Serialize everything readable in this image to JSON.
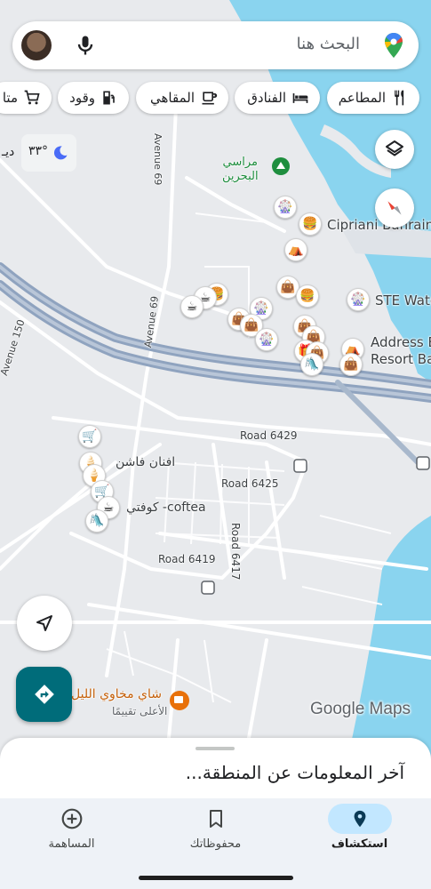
{
  "search": {
    "placeholder": "البحث هنا"
  },
  "chips": [
    {
      "label": "المطاعم",
      "icon": "fork-knife-icon"
    },
    {
      "label": "الفنادق",
      "icon": "bed-icon"
    },
    {
      "label": "المقاهي",
      "icon": "coffee-icon"
    },
    {
      "label": "وقود",
      "icon": "gas-pump-icon"
    },
    {
      "label": "متا",
      "icon": "cart-icon"
    }
  ],
  "weather": {
    "temp": "٣٣°",
    "city": "ديـ"
  },
  "map_labels": {
    "marina": "مراسي\nالبحرين",
    "cipriani": "Cipriani Bahrain",
    "ste": "STE Wate",
    "address": "Address B\nResort Ba",
    "afnan": "افنان فاشن",
    "coftea": "coftea- كوفتي",
    "shay": "شاي مخاوي الليل",
    "shay_sub": "الأعلى تقييمًا",
    "avenue69a": "Avenue 69",
    "avenue69b": "Avenue 69",
    "avenue150": "Avenue 150",
    "road6429": "Road 6429",
    "road6425": "Road 6425",
    "road6419": "Road 6419",
    "road6417": "Road 6417"
  },
  "google_maps": "Google Maps",
  "sheet": {
    "title": "آخر المعلومات عن المنطقة..."
  },
  "nav": [
    {
      "label": "المساهمة",
      "icon": "plus-circle-icon"
    },
    {
      "label": "محفوظاتك",
      "icon": "bookmark-icon"
    },
    {
      "label": "استكشاف",
      "icon": "location-pin-icon",
      "active": true
    }
  ],
  "colors": {
    "water": "#8ad4ef",
    "land": "#e8eaed",
    "road": "#ffffff",
    "highway": "#8fa3bf",
    "accent": "#006c7a"
  }
}
